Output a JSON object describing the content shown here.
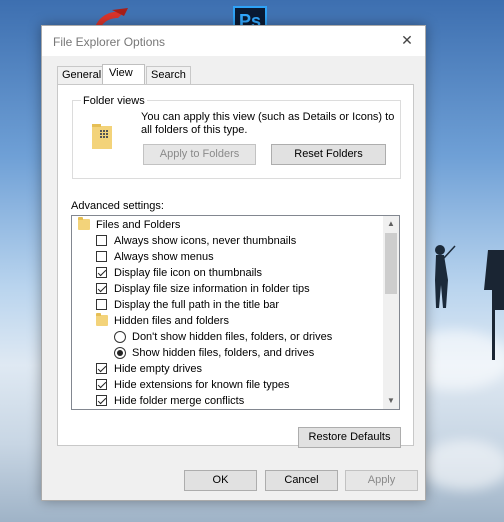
{
  "dialog": {
    "title": "File Explorer Options",
    "close_icon": "close-icon"
  },
  "tabs": [
    {
      "label": "General"
    },
    {
      "label": "View",
      "active": true
    },
    {
      "label": "Search"
    }
  ],
  "folder_views": {
    "label": "Folder views",
    "description": "You can apply this view (such as Details or Icons) to all folders of this type.",
    "apply_button": "Apply to Folders",
    "reset_button": "Reset Folders"
  },
  "advanced": {
    "label": "Advanced settings:",
    "items": [
      {
        "type": "folder",
        "label": "Files and Folders",
        "indent": 0
      },
      {
        "type": "checkbox",
        "label": "Always show icons, never thumbnails",
        "checked": false,
        "indent": 1
      },
      {
        "type": "checkbox",
        "label": "Always show menus",
        "checked": false,
        "indent": 1
      },
      {
        "type": "checkbox",
        "label": "Display file icon on thumbnails",
        "checked": true,
        "indent": 1
      },
      {
        "type": "checkbox",
        "label": "Display file size information in folder tips",
        "checked": true,
        "indent": 1
      },
      {
        "type": "checkbox",
        "label": "Display the full path in the title bar",
        "checked": false,
        "indent": 1
      },
      {
        "type": "folder",
        "label": "Hidden files and folders",
        "indent": 1
      },
      {
        "type": "radio",
        "label": "Don't show hidden files, folders, or drives",
        "checked": false,
        "indent": 2
      },
      {
        "type": "radio",
        "label": "Show hidden files, folders, and drives",
        "checked": true,
        "indent": 2
      },
      {
        "type": "checkbox",
        "label": "Hide empty drives",
        "checked": true,
        "indent": 1
      },
      {
        "type": "checkbox",
        "label": "Hide extensions for known file types",
        "checked": true,
        "indent": 1
      },
      {
        "type": "checkbox",
        "label": "Hide folder merge conflicts",
        "checked": true,
        "indent": 1
      }
    ]
  },
  "restore_button": "Restore Defaults",
  "footer": {
    "ok": "OK",
    "cancel": "Cancel",
    "apply": "Apply"
  },
  "desktop": {
    "ps_icon_text": "Ps"
  }
}
